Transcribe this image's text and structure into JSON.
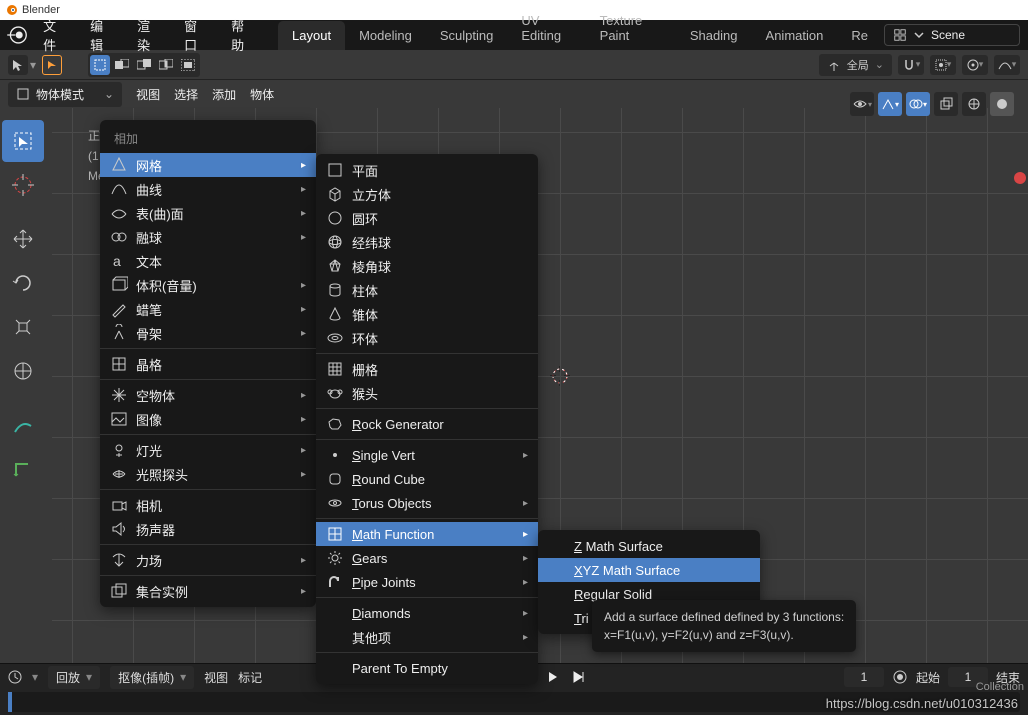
{
  "title_bar": {
    "app_name": "Blender"
  },
  "top_menu": {
    "items": [
      "文件",
      "编辑",
      "渲染",
      "窗口",
      "帮助"
    ]
  },
  "workspace_tabs": [
    "Layout",
    "Modeling",
    "Sculpting",
    "UV Editing",
    "Texture Paint",
    "Shading",
    "Animation",
    "Re"
  ],
  "scene_input": {
    "value": "Scene"
  },
  "toolbar": {
    "pivot_label": "全局"
  },
  "header": {
    "mode": "物体模式",
    "items": [
      "视图",
      "选择",
      "添加",
      "物体"
    ]
  },
  "pre_text": [
    "正",
    "(1",
    "Me"
  ],
  "menu1": {
    "header": "相加",
    "items": [
      {
        "label": "网格",
        "icon": "mesh",
        "sub": true,
        "highlight": true
      },
      {
        "label": "曲线",
        "icon": "curve",
        "sub": true
      },
      {
        "label": "表(曲)面",
        "icon": "surface",
        "sub": true
      },
      {
        "label": "融球",
        "icon": "meta",
        "sub": true
      },
      {
        "label": "文本",
        "icon": "text"
      },
      {
        "label": "体积(音量)",
        "icon": "volume",
        "sub": true
      },
      {
        "label": "蜡笔",
        "icon": "gpencil",
        "sub": true
      },
      {
        "label": "骨架",
        "icon": "armature",
        "sub": true
      },
      {
        "label": "晶格",
        "icon": "lattice"
      },
      {
        "label": "空物体",
        "icon": "empty",
        "sub": true
      },
      {
        "label": "图像",
        "icon": "image",
        "sub": true
      },
      {
        "label": "灯光",
        "icon": "light",
        "sub": true
      },
      {
        "label": "光照探头",
        "icon": "probe",
        "sub": true
      },
      {
        "label": "相机",
        "icon": "camera"
      },
      {
        "label": "扬声器",
        "icon": "speaker"
      },
      {
        "label": "力场",
        "icon": "force",
        "sub": true
      },
      {
        "label": "集合实例",
        "icon": "collection",
        "sub": true
      }
    ]
  },
  "menu2": {
    "groups": [
      {
        "items": [
          {
            "label": "平面",
            "icon": "plane"
          },
          {
            "label": "立方体",
            "icon": "cube"
          },
          {
            "label": "圆环",
            "icon": "circle"
          },
          {
            "label": "经纬球",
            "icon": "uvsphere"
          },
          {
            "label": "棱角球",
            "icon": "icosphere"
          },
          {
            "label": "柱体",
            "icon": "cylinder"
          },
          {
            "label": "锥体",
            "icon": "cone"
          },
          {
            "label": "环体",
            "icon": "torus"
          }
        ]
      },
      {
        "items": [
          {
            "label": "栅格",
            "icon": "grid"
          },
          {
            "label": "猴头",
            "icon": "monkey"
          }
        ]
      },
      {
        "items": [
          {
            "label": "Rock Generator",
            "icon": "rock",
            "u": 0
          }
        ]
      },
      {
        "items": [
          {
            "label": "Single Vert",
            "icon": "dot",
            "sub": true,
            "u": 0
          },
          {
            "label": "Round Cube",
            "icon": "rcube",
            "u": 0
          },
          {
            "label": "Torus Objects",
            "icon": "torus2",
            "sub": true,
            "u": 0
          }
        ]
      },
      {
        "items": [
          {
            "label": "Math Function",
            "icon": "math",
            "sub": true,
            "highlight": true,
            "u": 0
          },
          {
            "label": "Gears",
            "icon": "gear",
            "sub": true,
            "u": 0
          },
          {
            "label": "Pipe Joints",
            "icon": "pipe",
            "sub": true,
            "u": 0
          }
        ]
      },
      {
        "items": [
          {
            "label": "Diamonds",
            "sub": true,
            "u": 0
          },
          {
            "label": "其他项",
            "sub": true
          }
        ]
      },
      {
        "items": [
          {
            "label": "Parent To Empty"
          }
        ]
      }
    ]
  },
  "menu3": {
    "items": [
      {
        "label": "Z Math Surface",
        "u": 0
      },
      {
        "label": "XYZ Math Surface",
        "highlight": true,
        "u": 0
      },
      {
        "label": "Regular Solid",
        "u": 0
      },
      {
        "label": "Tri",
        "u": 0
      }
    ]
  },
  "tooltip": {
    "line1": "Add a surface defined defined by 3 functions:",
    "line2": "x=F1(u,v), y=F2(u,v) and z=F3(u,v)."
  },
  "timeline": {
    "playback": "回放",
    "keying": "抠像(插帧)",
    "view": "视图",
    "marker": "标记",
    "current": "1",
    "start_label": "起始",
    "start": "1",
    "end_label": "结束"
  },
  "watermark": "https://blog.csdn.net/u010312436",
  "collection_text": "Collection"
}
